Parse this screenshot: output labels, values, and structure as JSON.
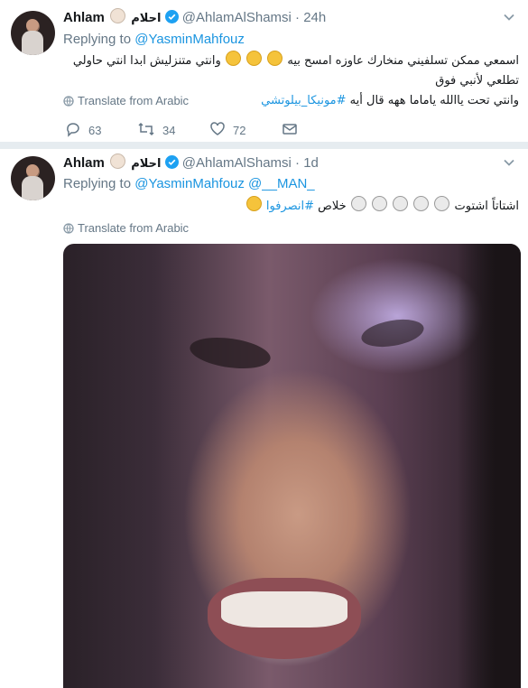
{
  "tweets": [
    {
      "name": "Ahlam",
      "name_arabic": "احلام",
      "handle": "@AhlamAlShamsi",
      "time": "· 24h",
      "replying_label": "Replying to",
      "replying_to": "@YasminMahfouz",
      "text_line1": "اسمعي ممكن تسلفيني منخارك عاوزه امسح بيه",
      "text_line1b": "وانتي متنزليش ابدا انتي حاولي تطلعي لأنبي فوق",
      "text_line2": "وانتي تحت ياالله ياماما ههه قال أيه",
      "hashtag": "#مونيكا_بيلوتشي",
      "translate": "Translate from Arabic",
      "replies": "63",
      "retweets": "34",
      "likes": "72"
    },
    {
      "name": "Ahlam",
      "name_arabic": "احلام",
      "handle": "@AhlamAlShamsi",
      "time": "· 1d",
      "replying_label": "Replying to",
      "replying_to": "@YasminMahfouz @__MAN_",
      "text_line1": "اشتاتاً اشتوت",
      "text_line1b": "خلاص",
      "hashtag": "#انصرفوا",
      "translate": "Translate from Arabic"
    }
  ],
  "colors": {
    "link": "#1b95e0",
    "muted": "#657786",
    "divider": "#e6ecf0"
  }
}
